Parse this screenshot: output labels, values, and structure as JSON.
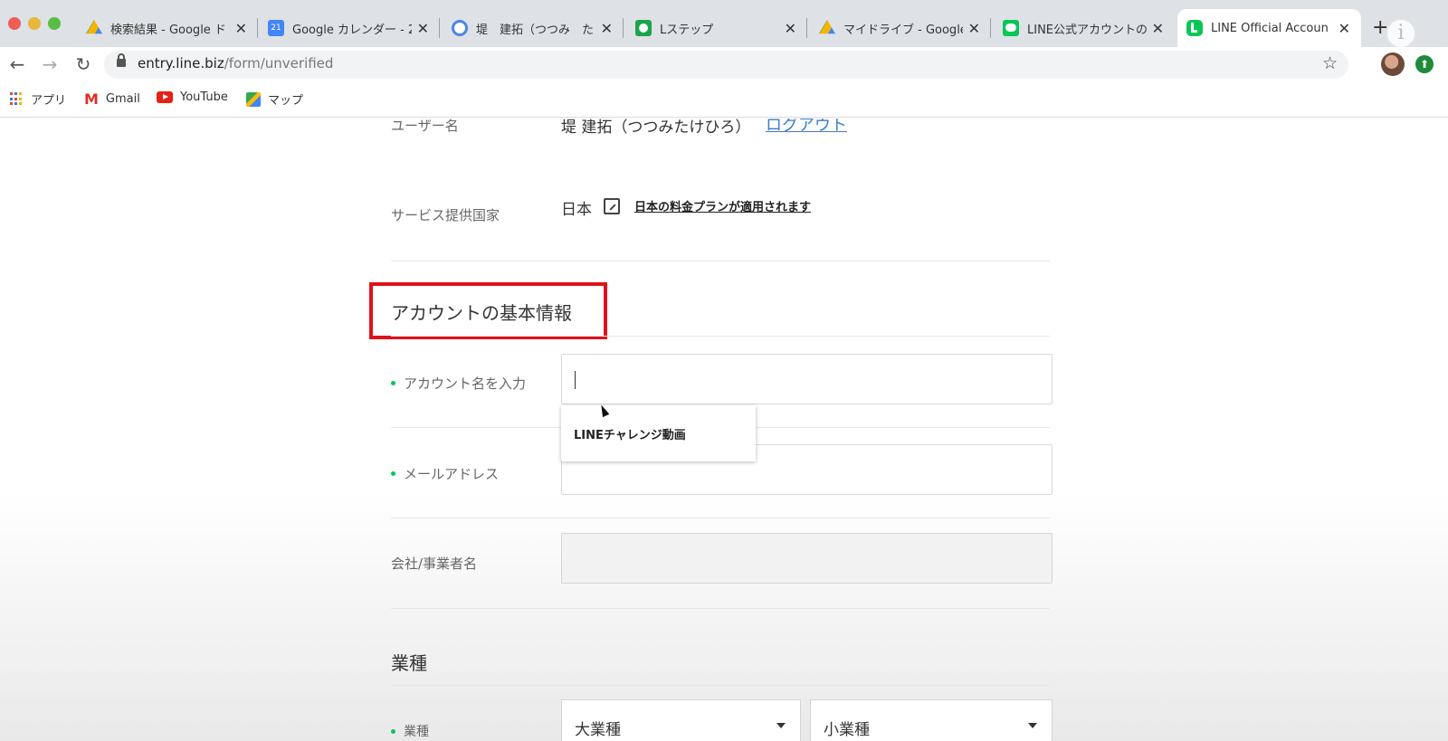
{
  "browser": {
    "tabs": [
      {
        "title": "検索結果 - Google ド",
        "favicon": "google-drive-icon"
      },
      {
        "title": "Google カレンダー - 2",
        "favicon": "google-calendar-icon"
      },
      {
        "title": "堤　建拓（つつみ　た",
        "favicon": "profile-icon"
      },
      {
        "title": "Lステップ",
        "favicon": "lstep-icon"
      },
      {
        "title": "マイドライブ - Google",
        "favicon": "google-drive-icon"
      },
      {
        "title": "LINE公式アカウントの",
        "favicon": "line-icon"
      },
      {
        "title": "LINE Official Accoun",
        "favicon": "line-official-icon",
        "active": true
      }
    ],
    "new_tab": "+",
    "info_badge": "i",
    "url_host": "entry.line.biz",
    "url_path": "/form/unverified",
    "bookmarks": [
      {
        "label": "アプリ",
        "icon": "apps-grid-icon"
      },
      {
        "label": "Gmail",
        "icon": "gmail-icon"
      },
      {
        "label": "YouTube",
        "icon": "youtube-icon"
      },
      {
        "label": "マップ",
        "icon": "maps-icon"
      }
    ]
  },
  "form": {
    "username_label": "ユーザー名",
    "username_value": "堤 建拓（つつみたけひろ）",
    "logout_label": "ログアウト",
    "country_label": "サービス提供国家",
    "country_value": "日本",
    "country_plan_link": "日本の料金プランが適用されます",
    "basic_info_title": "アカウントの基本情報",
    "account_name_label": "アカウント名を入力",
    "account_name_value": "",
    "account_name_suggestion": "LINEチャレンジ動画",
    "email_label": "メールアドレス",
    "email_value": "",
    "company_label": "会社/事業者名",
    "company_value": "",
    "industry_title": "業種",
    "industry_label": "業種",
    "industry_major_placeholder": "大業種",
    "industry_minor_placeholder": "小業種"
  },
  "colors": {
    "line_green": "#06c755",
    "highlight_red": "#e0111b",
    "link_blue": "#3d7cc9"
  }
}
